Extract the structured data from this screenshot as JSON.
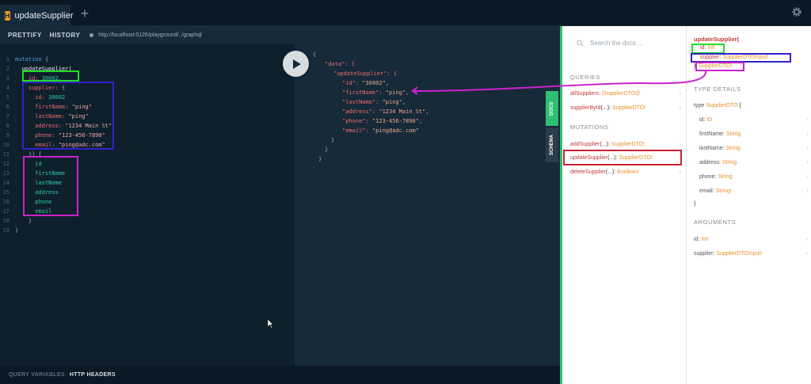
{
  "tab": {
    "logo": "H",
    "title": "updateSupplier",
    "close": "×",
    "add": "+"
  },
  "toolbar": {
    "prettify": "PRETTIFY",
    "history": "HISTORY",
    "url": "http://localhost:5126/playground/../graphql"
  },
  "bottombar": {
    "query_variables": "QUERY VARIABLES",
    "http_headers": "HTTP HEADERS"
  },
  "editor": {
    "line_numbers": [
      "1",
      "2",
      "3",
      "4",
      "5",
      "6",
      "7",
      "8",
      "9",
      "10",
      "11",
      "12",
      "13",
      "14",
      "15",
      "16",
      "17",
      "18",
      "19"
    ],
    "keyword_mutation": "mutation",
    "brace_open": "{",
    "brace_close": "}",
    "op_name": "updateSupplier(",
    "id_arg": "id:",
    "id_value": "30002,",
    "supplier_arg": "supplier:",
    "fields": [
      {
        "key": "id:",
        "value": "30002"
      },
      {
        "key": "firstName:",
        "value": "\"ping\""
      },
      {
        "key": "lastName:",
        "value": "\"ping\""
      },
      {
        "key": "address:",
        "value": "\"1234 Main St\""
      },
      {
        "key": "phone:",
        "value": "\"123-456-7890\""
      },
      {
        "key": "email:",
        "value": "\"ping@adc.com\""
      }
    ],
    "close_paren": "}) {",
    "selections": [
      "id",
      "firstName",
      "lastName",
      "address",
      "phone",
      "email"
    ]
  },
  "result": {
    "data_key": "\"data\": {",
    "op_key": "\"updateSupplier\": {",
    "fields": [
      {
        "key": "\"id\":",
        "value": "\"30002\","
      },
      {
        "key": "\"firstName\":",
        "value": "\"ping\","
      },
      {
        "key": "\"lastName\":",
        "value": "\"ping\","
      },
      {
        "key": "\"address\":",
        "value": "\"1234 Main St\","
      },
      {
        "key": "\"phone\":",
        "value": "\"123-456-7890\","
      },
      {
        "key": "\"email\":",
        "value": "\"ping@adc.com\""
      }
    ],
    "open": "{",
    "close": "}"
  },
  "sidetabs": {
    "docs": "DOCS",
    "schema": "SCHEMA"
  },
  "docs": {
    "search_placeholder": "Search the docs ...",
    "queries_title": "QUERIES",
    "queries": [
      {
        "name": "allSuppliers",
        "args": "",
        "type": "[SupplierDTO!]!"
      },
      {
        "name": "supplierById",
        "args": "(...)",
        "type": "SupplierDTO!"
      }
    ],
    "mutations_title": "MUTATIONS",
    "mutations": [
      {
        "name": "addSupplier",
        "args": "(...)",
        "type": "SupplierDTO!"
      },
      {
        "name": "updateSupplier",
        "args": "(...)",
        "type": "SupplierDTO!"
      },
      {
        "name": "deleteSupplier",
        "args": "(...)",
        "type": "Boolean!"
      }
    ]
  },
  "detail": {
    "title": "updateSupplier(",
    "arg_id": "id",
    "arg_id_type": "Int!",
    "arg_supplier": "supplier",
    "arg_supplier_type": "SupplierDTOInput!",
    "return_type": "SupplierDTO!",
    "type_details_title": "TYPE DETAILS",
    "type_decl_kw": "type",
    "type_decl_name": "SupplierDTO",
    "type_fields": [
      {
        "name": "id",
        "type": "ID"
      },
      {
        "name": "firstName",
        "type": "String"
      },
      {
        "name": "lastName",
        "type": "String"
      },
      {
        "name": "address",
        "type": "String"
      },
      {
        "name": "phone",
        "type": "String"
      },
      {
        "name": "email",
        "type": "String!"
      }
    ],
    "arguments_title": "ARGUMENTS",
    "arguments": [
      {
        "name": "id",
        "type": "Int!"
      },
      {
        "name": "supplier",
        "type": "SupplierDTOInput!"
      }
    ]
  },
  "colors": {
    "annot_green": "#22dd22",
    "annot_blue": "#3322cc",
    "annot_magenta": "#cc22cc",
    "annot_red": "#cc2233",
    "docs_border": "#2fbf71"
  }
}
